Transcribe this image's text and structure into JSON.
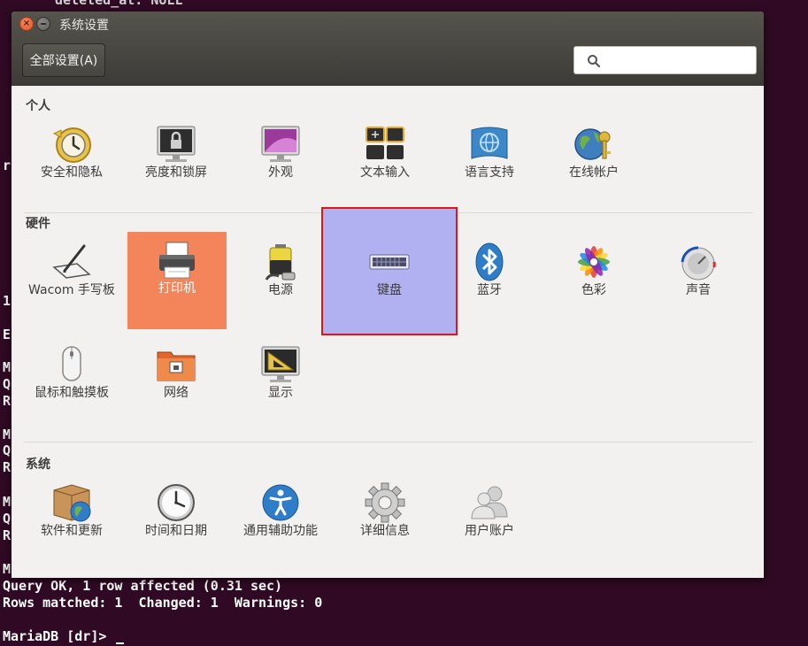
{
  "terminal": {
    "top_line": "deleted_at: NULL",
    "fragments": [
      "r",
      "1",
      "E",
      "M",
      "Q",
      "R",
      "M",
      "Q",
      "R",
      "M",
      "Q",
      "R",
      "M"
    ],
    "line_query_ok": "Query OK, 1 row affected (0.31 sec)",
    "line_rows": "Rows matched: 1  Changed: 1  Warnings: 0",
    "prompt": "MariaDB [dr]> "
  },
  "window": {
    "title": "系统设置",
    "all_settings_label": "全部设置(A)",
    "search_placeholder": ""
  },
  "sections": [
    {
      "title": "个人",
      "items": [
        {
          "label": "安全和隐私",
          "icon": "security-privacy-icon"
        },
        {
          "label": "亮度和锁屏",
          "icon": "brightness-lock-icon"
        },
        {
          "label": "外观",
          "icon": "appearance-icon"
        },
        {
          "label": "文本输入",
          "icon": "text-entry-icon"
        },
        {
          "label": "语言支持",
          "icon": "language-support-icon"
        },
        {
          "label": "在线帐户",
          "icon": "online-accounts-icon"
        }
      ]
    },
    {
      "title": "硬件",
      "items": [
        {
          "label": "Wacom 手写板",
          "icon": "wacom-tablet-icon"
        },
        {
          "label": "打印机",
          "icon": "printer-icon"
        },
        {
          "label": "电源",
          "icon": "power-icon"
        },
        {
          "label": "键盘",
          "icon": "keyboard-icon"
        },
        {
          "label": "蓝牙",
          "icon": "bluetooth-icon"
        },
        {
          "label": "色彩",
          "icon": "color-icon"
        },
        {
          "label": "声音",
          "icon": "sound-icon"
        },
        {
          "label": "鼠标和触摸板",
          "icon": "mouse-touchpad-icon"
        },
        {
          "label": "网络",
          "icon": "network-icon"
        },
        {
          "label": "显示",
          "icon": "display-icon"
        }
      ]
    },
    {
      "title": "系统",
      "items": [
        {
          "label": "软件和更新",
          "icon": "software-updates-icon"
        },
        {
          "label": "时间和日期",
          "icon": "time-date-icon"
        },
        {
          "label": "通用辅助功能",
          "icon": "universal-access-icon"
        },
        {
          "label": "详细信息",
          "icon": "details-icon"
        },
        {
          "label": "用户账户",
          "icon": "user-accounts-icon"
        }
      ]
    }
  ],
  "highlight": {
    "hover_item": "打印机",
    "selected_item": "键盘"
  },
  "colors": {
    "hover": "#f4855a",
    "selected_bg": "#b1b0f0",
    "selected_border": "#e01515",
    "terminal_bg": "#300a24"
  }
}
